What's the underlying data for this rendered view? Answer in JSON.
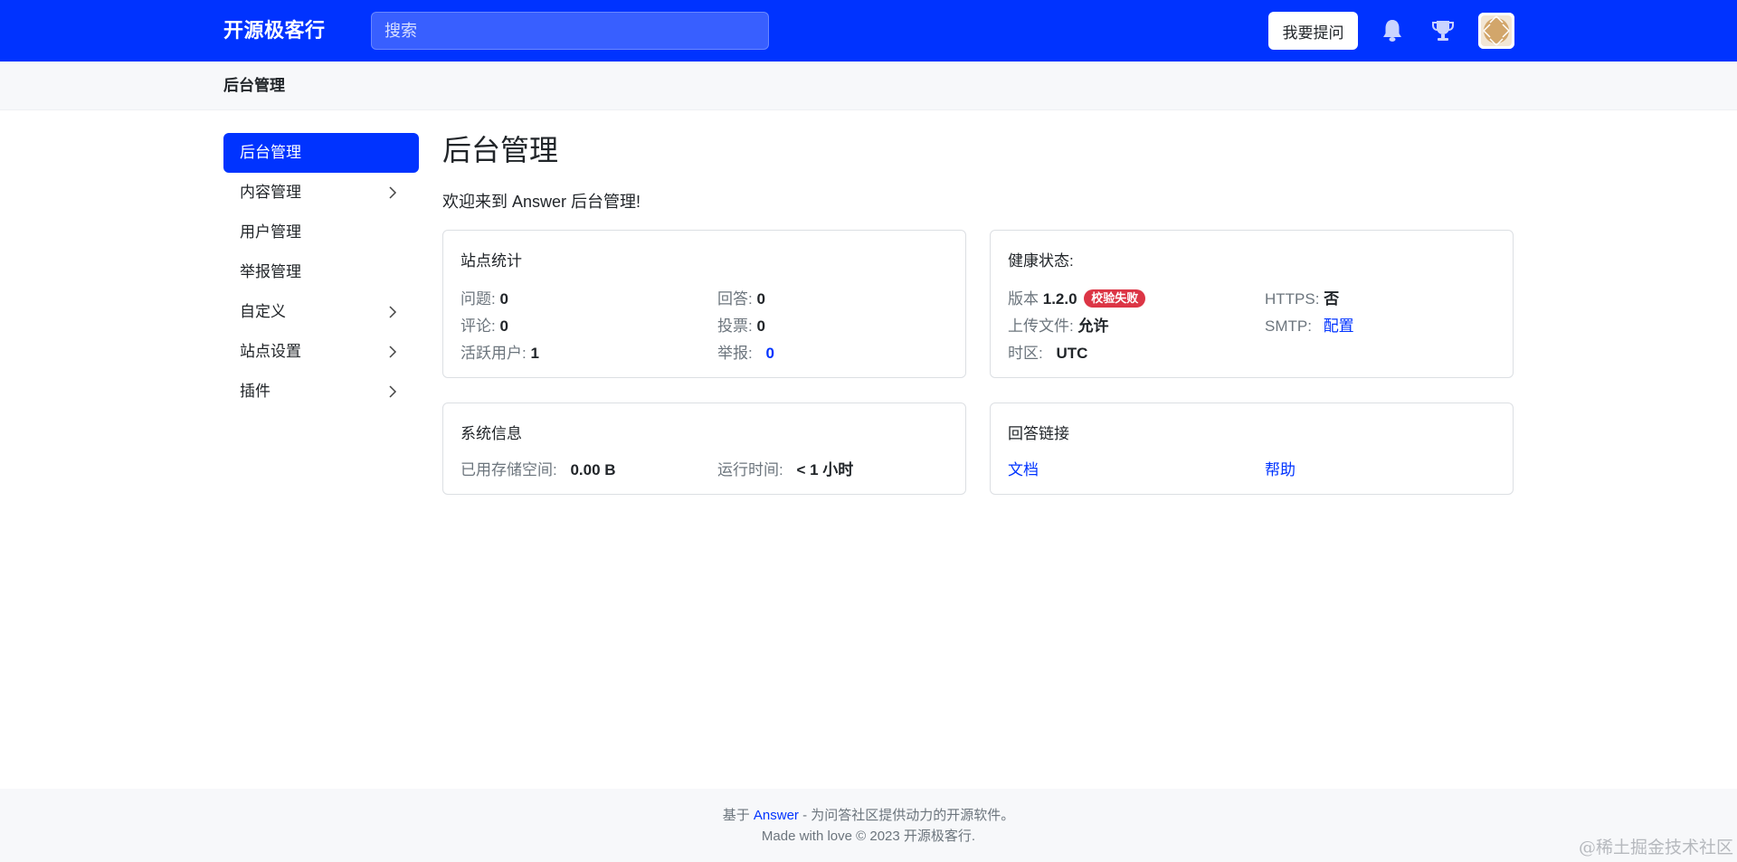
{
  "header": {
    "brand": "开源极客行",
    "search_placeholder": "搜索",
    "ask_button": "我要提问",
    "icons": [
      "bell-icon",
      "trophy-icon"
    ],
    "accent_color": "#0033ff"
  },
  "breadcrumb": {
    "title": "后台管理"
  },
  "sidebar": {
    "items": [
      {
        "label": "后台管理",
        "active": true,
        "has_children": false
      },
      {
        "label": "内容管理",
        "active": false,
        "has_children": true
      },
      {
        "label": "用户管理",
        "active": false,
        "has_children": false
      },
      {
        "label": "举报管理",
        "active": false,
        "has_children": false
      },
      {
        "label": "自定义",
        "active": false,
        "has_children": true
      },
      {
        "label": "站点设置",
        "active": false,
        "has_children": true
      },
      {
        "label": "插件",
        "active": false,
        "has_children": true
      }
    ]
  },
  "main": {
    "title": "后台管理",
    "welcome": "欢迎来到 Answer 后台管理!"
  },
  "site_stats": {
    "title": "站点统计",
    "questions_label": "问题:",
    "questions": "0",
    "answers_label": "回答:",
    "answers": "0",
    "comments_label": "评论:",
    "comments": "0",
    "votes_label": "投票:",
    "votes": "0",
    "active_users_label": "活跃用户:",
    "active_users": "1",
    "reports_label": "举报:",
    "reports": "0"
  },
  "health": {
    "title": "健康状态:",
    "version_label": "版本",
    "version": "1.2.0",
    "version_badge": "校验失败",
    "https_label": "HTTPS:",
    "https": "否",
    "upload_label": "上传文件:",
    "upload": "允许",
    "smtp_label": "SMTP:",
    "smtp": "配置",
    "timezone_label": "时区:",
    "timezone": "UTC",
    "badge_color": "#dc3545"
  },
  "system": {
    "title": "系统信息",
    "storage_label": "已用存储空间:",
    "storage": "0.00 B",
    "uptime_label": "运行时间:",
    "uptime": "< 1 小时"
  },
  "answer_links": {
    "title": "回答链接",
    "docs": "文档",
    "help": "帮助"
  },
  "footer": {
    "prefix": "基于",
    "link": "Answer",
    "suffix": "- 为问答社区提供动力的开源软件。",
    "line2": "Made with love © 2023 开源极客行."
  },
  "watermark": "@稀土掘金技术社区"
}
